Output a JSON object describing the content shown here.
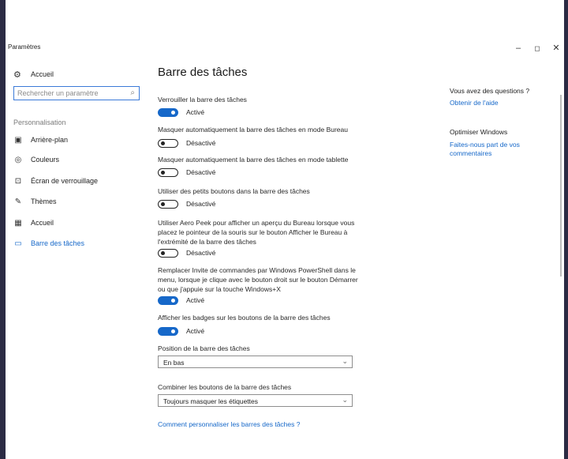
{
  "window": {
    "title": "Paramètres",
    "controls": {
      "minimize": "–",
      "maximize": "◻",
      "close": "✕"
    }
  },
  "sidebar": {
    "home_label": "Accueil",
    "search_placeholder": "Rechercher un paramètre",
    "section_label": "Personnalisation",
    "items": [
      {
        "label": "Arrière-plan",
        "icon": "image-icon",
        "glyph": "▣"
      },
      {
        "label": "Couleurs",
        "icon": "palette-icon",
        "glyph": "◎"
      },
      {
        "label": "Écran de verrouillage",
        "icon": "lock-screen-icon",
        "glyph": "⊡"
      },
      {
        "label": "Thèmes",
        "icon": "themes-icon",
        "glyph": "✎"
      },
      {
        "label": "Accueil",
        "icon": "start-icon",
        "glyph": "▦"
      },
      {
        "label": "Barre des tâches",
        "icon": "taskbar-icon",
        "glyph": "▭"
      }
    ]
  },
  "main": {
    "title": "Barre des tâches",
    "settings": [
      {
        "label": "Verrouiller la barre des tâches",
        "state": "Activé"
      },
      {
        "label": "Masquer automatiquement la barre des tâches en mode Bureau",
        "state": "Désactivé"
      },
      {
        "label": "Masquer automatiquement la barre des tâches en mode tablette",
        "state": "Désactivé"
      },
      {
        "label": "Utiliser des petits boutons dans la barre des tâches",
        "state": "Désactivé"
      },
      {
        "label": "Utiliser Aero Peek pour afficher un aperçu du Bureau lorsque vous placez le pointeur de la souris sur le bouton Afficher le Bureau à l'extrémité de la barre des tâches",
        "state": "Désactivé"
      },
      {
        "label": "Remplacer Invite de commandes par Windows PowerShell dans le menu, lorsque je clique avec le bouton droit sur le bouton Démarrer ou que j'appuie sur la touche Windows+X",
        "state": "Activé"
      },
      {
        "label": "Afficher les badges sur les boutons de la barre des tâches",
        "state": "Activé"
      }
    ],
    "position": {
      "label": "Position de la barre des tâches",
      "value": "En bas"
    },
    "combine": {
      "label": "Combiner les boutons de la barre des tâches",
      "value": "Toujours masquer les étiquettes"
    },
    "help_link": "Comment personnaliser les barres des tâches ?"
  },
  "right_pane": {
    "questions_title": "Vous avez des questions ?",
    "help_link": "Obtenir de l'aide",
    "improve_title": "Optimiser Windows",
    "feedback_link": "Faites-nous part de vos commentaires"
  },
  "colors": {
    "accent": "#1668c9",
    "frame": "#2b2b44"
  }
}
